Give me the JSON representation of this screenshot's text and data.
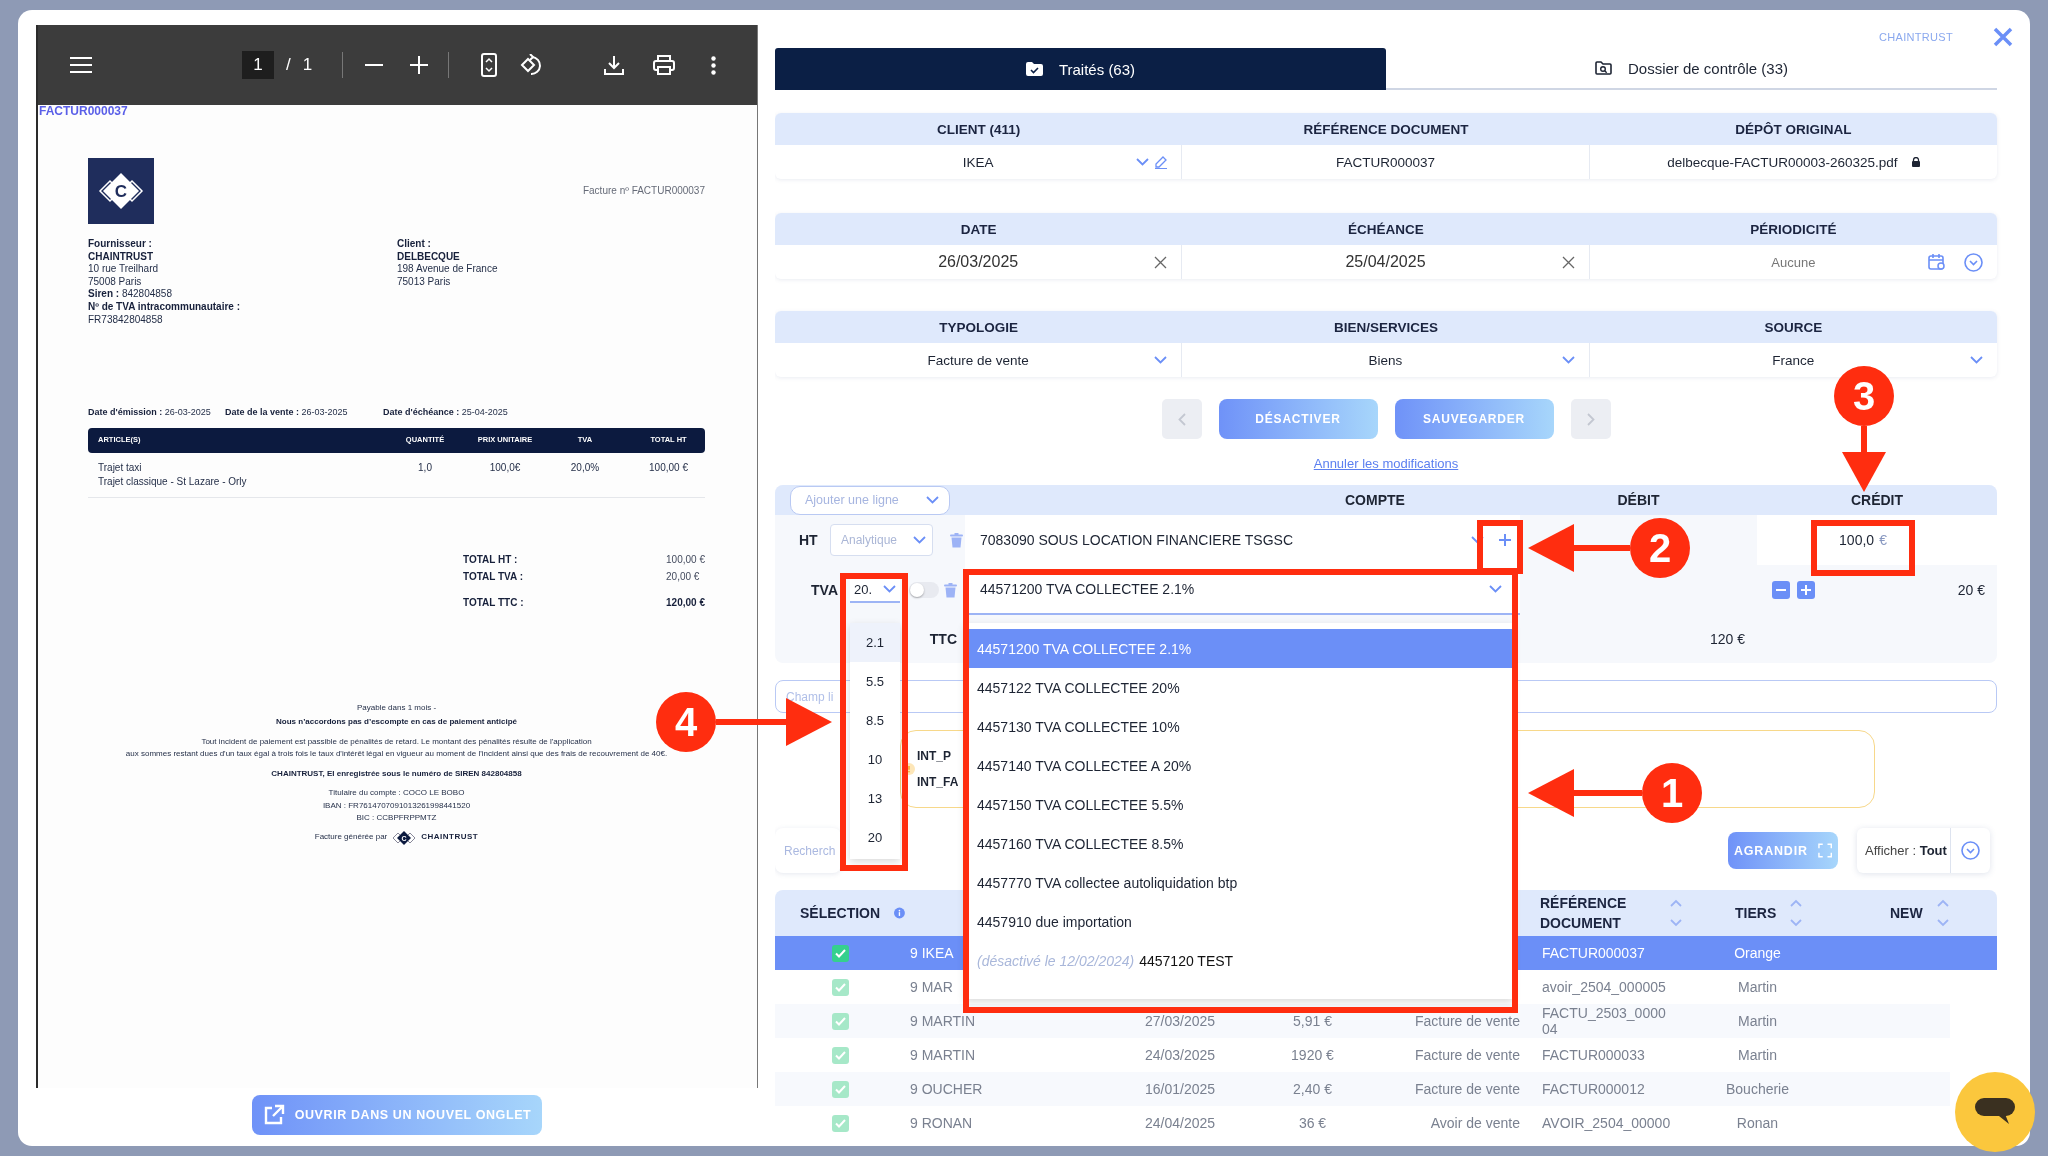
{
  "viewer": {
    "page": "1",
    "page_sep": "/",
    "page_total": "1",
    "doc_link": "FACTUR000037",
    "open_button": "OUVRIR DANS UN NOUVEL ONGLET"
  },
  "invoice": {
    "logo_letter": "C",
    "number": "Facture nº FACTUR000037",
    "supplier": {
      "label": "Fournisseur :",
      "name": "CHAINTRUST",
      "lines": [
        "10 rue Treilhard",
        "75008 Paris"
      ],
      "siren_label": "Siren :",
      "siren": "842804858",
      "vat_label": "Nº de TVA intracommunautaire :",
      "vat": "FR73842804858"
    },
    "client": {
      "label": "Client :",
      "name": "DELBECQUE",
      "lines": [
        "198 Avenue de France",
        "75013 Paris"
      ]
    },
    "dates": [
      {
        "label": "Date d'émission :",
        "value": "26-03-2025"
      },
      {
        "label": "Date de la vente :",
        "value": "26-03-2025"
      },
      {
        "label": "Date d'échéance :",
        "value": "25-04-2025"
      }
    ],
    "columns": [
      "ARTICLE(S)",
      "QUANTITÉ",
      "PRIX UNITAIRE",
      "TVA",
      "TOTAL HT"
    ],
    "items": [
      {
        "name": "Trajet taxi",
        "detail": "Trajet classique - St Lazare - Orly",
        "qty": "1,0",
        "unit_price": "100,0€",
        "vat": "20,0%",
        "total": "100,00 €"
      }
    ],
    "totals": [
      {
        "label": "TOTAL HT :",
        "value": "100,00 €",
        "bold": false
      },
      {
        "label": "TOTAL TVA :",
        "value": "20,00 €",
        "bold": false
      },
      {
        "label": "TOTAL TTC :",
        "value": "120,00 €",
        "bold": true
      }
    ],
    "footer": {
      "terms": "Payable dans 1 mois -",
      "no_discount": "Nous n’accordons pas d’escompte en cas de paiement anticipé",
      "penalties": [
        "Tout incident de paiement est passible de pénalités de retard. Le montant des pénalités résulte de l'application",
        "aux sommes restant dues d'un taux égal à trois fois le taux d'intérêt légal en vigueur au moment de l'incident ainsi que des frais de recouvrement de 40€."
      ],
      "registration": "CHAINTRUST, EI enregistrée sous le numéro de SIREN 842804858",
      "bank": [
        "Titulaire du compte : COCO LE BOBO",
        "IBAN : FR7614707091013261998441520",
        "BIC : CCBPFRPPMTZ"
      ],
      "generated_by": "Facture générée par",
      "brand_letter": "C",
      "brand": "CHAINTRUST"
    }
  },
  "panel": {
    "brand": "CHAINTRUST"
  },
  "tabs": [
    {
      "label": "Traités (63)",
      "selected": true
    },
    {
      "label": "Dossier de contrôle (33)",
      "selected": false
    }
  ],
  "sections": [
    [
      {
        "label": "CLIENT (411)",
        "value": "IKEA",
        "kind": "select-edit"
      },
      {
        "label": "RÉFÉRENCE DOCUMENT",
        "value": "FACTUR000037",
        "kind": "text"
      },
      {
        "label": "DÉPÔT ORIGINAL",
        "value": "delbecque-FACTUR00003-260325.pdf",
        "kind": "file"
      }
    ],
    [
      {
        "label": "DATE",
        "value": "26/03/2025",
        "kind": "date"
      },
      {
        "label": "ÉCHÉANCE",
        "value": "25/04/2025",
        "kind": "date"
      },
      {
        "label": "PÉRIODICITÉ",
        "placeholder": "Aucune",
        "kind": "periodic"
      }
    ],
    [
      {
        "label": "TYPOLOGIE",
        "value": "Facture de vente",
        "kind": "select"
      },
      {
        "label": "BIEN/SERVICES",
        "value": "Biens",
        "kind": "select"
      },
      {
        "label": "SOURCE",
        "value": "France",
        "kind": "select"
      }
    ]
  ],
  "actions": {
    "prev_disabled": true,
    "buttons": [
      "DÉSACTIVER",
      "SAUVEGARDER"
    ],
    "next_disabled": true,
    "cancel_link": "Annuler les modifications"
  },
  "entries": {
    "add_line": "Ajouter une ligne",
    "columns": [
      "COMPTE",
      "DÉBIT",
      "CRÉDIT"
    ],
    "lines": [
      {
        "kind": "ht",
        "label": "HT",
        "analytic": "Analytique",
        "account": "7083090 SOUS LOCATION FINANCIERE TSGSC",
        "credit": "100,0",
        "currency": "€"
      },
      {
        "kind": "tva",
        "label": "TVA",
        "rate": "20.",
        "toggle_on": false,
        "account": "44571200 TVA COLLECTEE 2.1%",
        "credit": "20 €"
      },
      {
        "kind": "ttc",
        "label": "TTC",
        "debit": "120 €"
      }
    ],
    "rate_options": [
      {
        "label": "2.1",
        "selected": true
      },
      {
        "label": "5.5",
        "selected": false
      },
      {
        "label": "8.5",
        "selected": false
      },
      {
        "label": "10",
        "selected": false
      },
      {
        "label": "13",
        "selected": false
      },
      {
        "label": "20",
        "selected": false
      }
    ],
    "account_options": [
      {
        "label": "44571200 TVA COLLECTEE 2.1%",
        "selected": true,
        "disabled": false
      },
      {
        "label": "4457122 TVA COLLECTEE 20%",
        "selected": false,
        "disabled": false
      },
      {
        "label": "4457130 TVA COLLECTEE 10%",
        "selected": false,
        "disabled": false
      },
      {
        "label": "4457140 TVA COLLECTEE A 20%",
        "selected": false,
        "disabled": false
      },
      {
        "label": "4457150 TVA COLLECTEE 5.5%",
        "selected": false,
        "disabled": false
      },
      {
        "label": "4457160 TVA COLLECTEE 8.5%",
        "selected": false,
        "disabled": false
      },
      {
        "label": "4457770 TVA collectee autoliquidation btp",
        "selected": false,
        "disabled": false
      },
      {
        "label": "4457910 due importation",
        "selected": false,
        "disabled": false
      },
      {
        "note": "(désactivé le 12/02/2024)",
        "label": "4457120 TEST",
        "selected": false,
        "disabled": true
      }
    ]
  },
  "notes": {
    "free_field_placeholder": "Champ li",
    "warnings": [
      "INT_P",
      "INT_FA"
    ]
  },
  "toolbar": {
    "search_placeholder": "Recherch",
    "expand": "AGRANDIR",
    "filter_label": "Afficher :",
    "filter_value": "Tout"
  },
  "table": {
    "columns": [
      {
        "label": "SÉLECTION",
        "kind": "info"
      },
      {
        "label": "RÉFÉRENCE DOCUMENT",
        "kind": "sort"
      },
      {
        "label": "TIERS",
        "kind": "sort"
      },
      {
        "label": "NEW",
        "kind": "sort"
      }
    ],
    "rows": [
      {
        "selected": true,
        "checked": true,
        "name": "9 IKEA",
        "reference": "FACTUR000037",
        "third_party": "Orange"
      },
      {
        "selected": false,
        "checked": true,
        "name": "9 MAR",
        "reference": "avoir_2504_000005",
        "third_party": "Martin"
      },
      {
        "selected": false,
        "checked": true,
        "name": "9 MARTIN",
        "date": "27/03/2025",
        "amount": "5,91 €",
        "type": "Facture de vente",
        "reference": "FACTU_2503_000004",
        "third_party": "Martin"
      },
      {
        "selected": false,
        "checked": true,
        "name": "9 MARTIN",
        "date": "24/03/2025",
        "amount": "1920 €",
        "type": "Facture de vente",
        "reference": "FACTUR000033",
        "third_party": "Martin"
      },
      {
        "selected": false,
        "checked": true,
        "name": "9 OUCHER",
        "date": "16/01/2025",
        "amount": "2,40 €",
        "type": "Facture de vente",
        "reference": "FACTUR000012",
        "third_party": "Boucherie"
      },
      {
        "selected": false,
        "checked": true,
        "name": "9 RONAN",
        "date": "24/04/2025",
        "amount": "36 €",
        "type": "Avoir de vente",
        "reference": "AVOIR_2504_00000",
        "third_party": "Ronan"
      }
    ]
  },
  "annotations": [
    {
      "number": "1"
    },
    {
      "number": "2"
    },
    {
      "number": "3"
    },
    {
      "number": "4"
    }
  ]
}
